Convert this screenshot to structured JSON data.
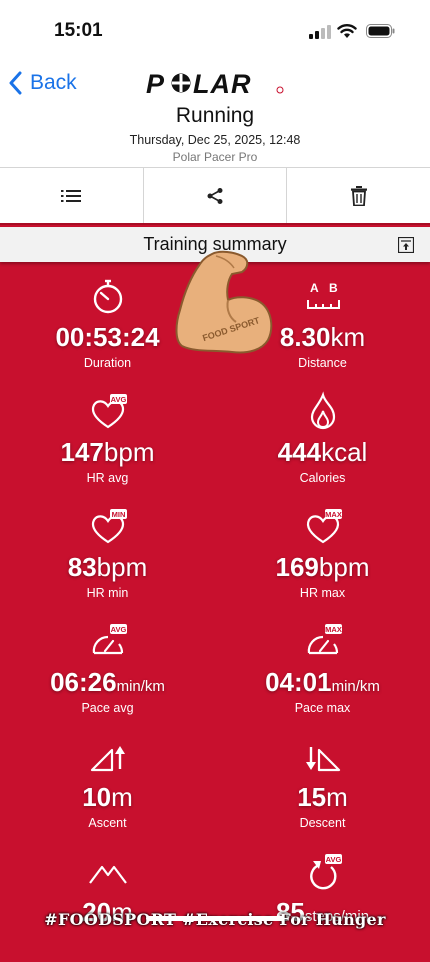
{
  "status": {
    "time": "15:01"
  },
  "nav": {
    "back_label": "Back",
    "brand": "POLAR"
  },
  "header": {
    "title": "Running",
    "datetime": "Thursday, Dec 25, 2025, 12:48",
    "device": "Polar Pacer Pro"
  },
  "summary": {
    "title": "Training summary"
  },
  "metrics": [
    {
      "value": "00:53:24",
      "unit": "",
      "label": "Duration",
      "icon": "stopwatch-icon"
    },
    {
      "value": "8.30",
      "unit": "km",
      "label": "Distance",
      "icon": "distance-icon",
      "icon_text_a": "A",
      "icon_text_b": "B"
    },
    {
      "value": "147",
      "unit": "bpm",
      "label": "HR avg",
      "icon": "heart-avg-icon",
      "badge": "AVG"
    },
    {
      "value": "444",
      "unit": "kcal",
      "label": "Calories",
      "icon": "flame-icon"
    },
    {
      "value": "83",
      "unit": "bpm",
      "label": "HR min",
      "icon": "heart-min-icon",
      "badge": "MIN"
    },
    {
      "value": "169",
      "unit": "bpm",
      "label": "HR max",
      "icon": "heart-max-icon",
      "badge": "MAX"
    },
    {
      "value": "06:26",
      "unit": "min/km",
      "label": "Pace avg",
      "icon": "pace-avg-icon",
      "badge": "AVG"
    },
    {
      "value": "04:01",
      "unit": "min/km",
      "label": "Pace max",
      "icon": "pace-max-icon",
      "badge": "MAX"
    },
    {
      "value": "10",
      "unit": "m",
      "label": "Ascent",
      "icon": "ascent-icon"
    },
    {
      "value": "15",
      "unit": "m",
      "label": "Descent",
      "icon": "descent-icon"
    },
    {
      "value": "20",
      "unit": "m",
      "label": "",
      "icon": "altitude-icon"
    },
    {
      "value": "85",
      "unit": "steps/min",
      "label": "",
      "icon": "cadence-icon",
      "badge": "AVG"
    }
  ],
  "overlay": {
    "sticker_text": "FOOD SPORT",
    "watermark": "#FOODSPORT #Exercise For Hunger"
  },
  "colors": {
    "accent": "#c8102e",
    "link": "#1a73e8"
  }
}
